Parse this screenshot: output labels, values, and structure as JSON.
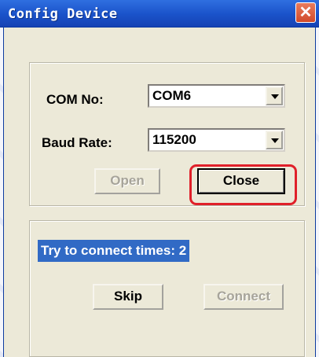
{
  "window": {
    "title": "Config Device",
    "close_glyph": "✕"
  },
  "port_group": {
    "com_label": "COM No:",
    "com_value": "COM6",
    "baud_label": "Baud Rate:",
    "baud_value": "115200",
    "open_label": "Open",
    "close_label": "Close"
  },
  "connect_group": {
    "status_text": "Try to connect times: 2",
    "skip_label": "Skip",
    "connect_label": "Connect"
  },
  "colors": {
    "titlebar": "#1a52c9",
    "highlight_ring": "#e0202a",
    "selection": "#316ac5"
  }
}
